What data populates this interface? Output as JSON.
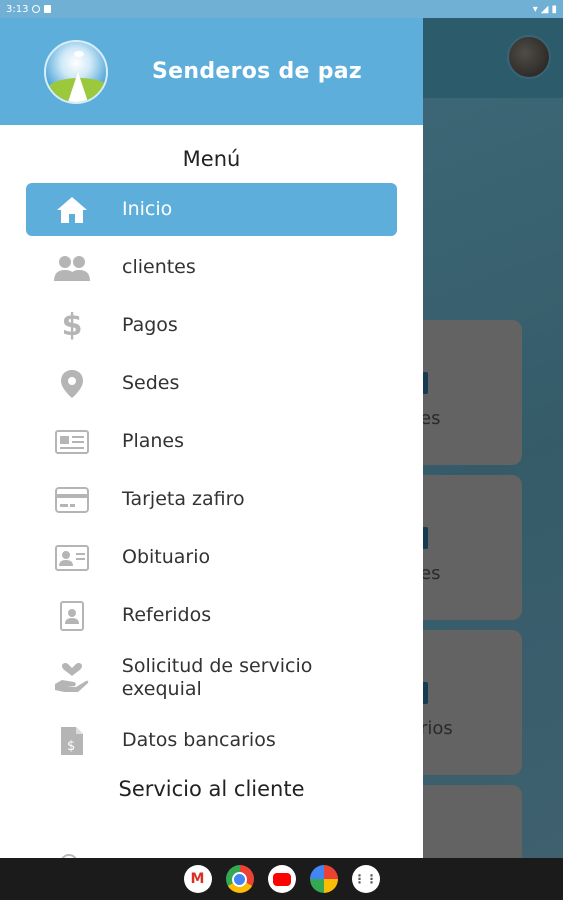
{
  "status_bar": {
    "time": "3:13"
  },
  "app_title": "Senderos de paz",
  "menu_heading": "Menú",
  "menu_items": [
    {
      "label": "Inicio",
      "icon": "home-icon",
      "active": true
    },
    {
      "label": "clientes",
      "icon": "users-icon"
    },
    {
      "label": "Pagos",
      "icon": "dollar-icon"
    },
    {
      "label": "Sedes",
      "icon": "location-pin-icon"
    },
    {
      "label": "Planes",
      "icon": "newspaper-icon"
    },
    {
      "label": "Tarjeta zafiro",
      "icon": "credit-card-icon"
    },
    {
      "label": "Obituario",
      "icon": "id-card-icon"
    },
    {
      "label": "Referidos",
      "icon": "contact-book-icon"
    },
    {
      "label": "Solicitud de servicio exequial",
      "icon": "hand-heart-icon"
    },
    {
      "label": "Datos bancarios",
      "icon": "bank-document-icon"
    }
  ],
  "section2_heading": "Servicio al cliente",
  "background_cards": [
    "es",
    "es",
    "rios"
  ],
  "colors": {
    "primary": "#5eaedc",
    "icon_gray": "#b5b5b5"
  },
  "nav_apps": [
    "Gmail",
    "Chrome",
    "YouTube",
    "Photos",
    "App launcher"
  ]
}
